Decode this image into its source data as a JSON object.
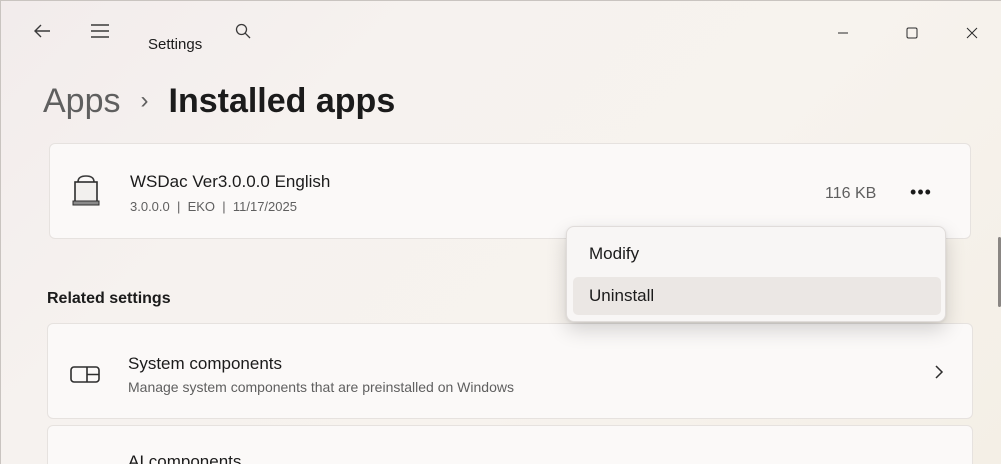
{
  "window": {
    "title": "Settings",
    "controls": {
      "minimize": "minimize-icon",
      "maximize": "maximize-icon",
      "close": "close-icon"
    }
  },
  "nav": {
    "back_icon": "back-arrow-icon",
    "menu_icon": "hamburger-menu-icon",
    "search_icon": "search-icon"
  },
  "breadcrumb": {
    "parent": "Apps",
    "separator": "›",
    "current": "Installed apps"
  },
  "app": {
    "name": "WSDac Ver3.0.0.0 English",
    "meta": "3.0.0.0  |  EKO  |  11/17/2025",
    "size": "116 KB",
    "more_label": "•••",
    "icon": "app-package-icon"
  },
  "context_menu": {
    "items": [
      "Modify",
      "Uninstall"
    ],
    "hovered": "Uninstall"
  },
  "related": {
    "title": "Related settings",
    "items": [
      {
        "title": "System components",
        "description": "Manage system components that are preinstalled on Windows",
        "icon": "system-components-icon"
      },
      {
        "title": "AI components",
        "icon": "ai-components-icon"
      }
    ]
  },
  "colors": {
    "background": "#f3f0ee",
    "card": "#fbf9f8",
    "text": "#1b1b1b",
    "secondary_text": "#5f5f5f",
    "menu_hover": "#ebe7e4"
  }
}
